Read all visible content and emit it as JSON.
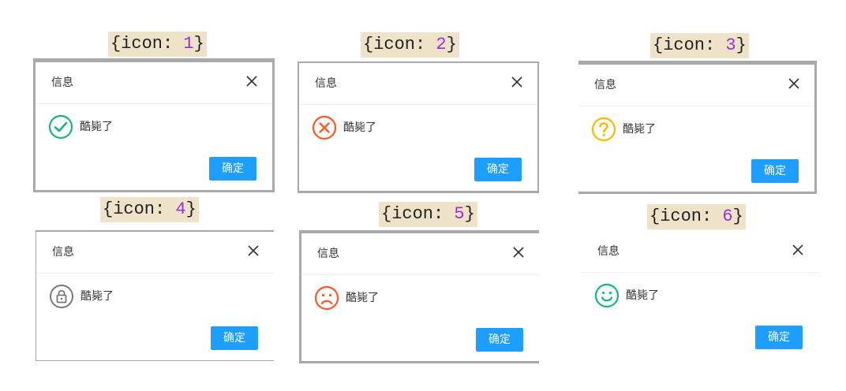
{
  "dialogs": [
    {
      "label_prefix": "{icon: ",
      "label_num": "1",
      "label_suffix": "}",
      "title": "信息",
      "message": "酷毙了",
      "ok_label": "确定",
      "icon": "check-circle-icon",
      "icon_color": "#16b777"
    },
    {
      "label_prefix": "{icon: ",
      "label_num": "2",
      "label_suffix": "}",
      "title": "信息",
      "message": "酷毙了",
      "ok_label": "确定",
      "icon": "x-circle-icon",
      "icon_color": "#ff5722"
    },
    {
      "label_prefix": "{icon: ",
      "label_num": "3",
      "label_suffix": "}",
      "title": "信息",
      "message": "酷毙了",
      "ok_label": "确定",
      "icon": "question-circle-icon",
      "icon_color": "#ffb800"
    },
    {
      "label_prefix": "{icon: ",
      "label_num": "4",
      "label_suffix": "}",
      "title": "信息",
      "message": "酷毙了",
      "ok_label": "确定",
      "icon": "lock-circle-icon",
      "icon_color": "#777777"
    },
    {
      "label_prefix": "{icon: ",
      "label_num": "5",
      "label_suffix": "}",
      "title": "信息",
      "message": "酷毙了",
      "ok_label": "确定",
      "icon": "sad-face-icon",
      "icon_color": "#ff5722"
    },
    {
      "label_prefix": "{icon: ",
      "label_num": "6",
      "label_suffix": "}",
      "title": "信息",
      "message": "酷毙了",
      "ok_label": "确定",
      "icon": "smile-face-icon",
      "icon_color": "#16b777"
    }
  ],
  "colors": {
    "primary_button": "#1e9fff",
    "label_background": "#eee2c8",
    "label_number": "#9b30d9"
  }
}
